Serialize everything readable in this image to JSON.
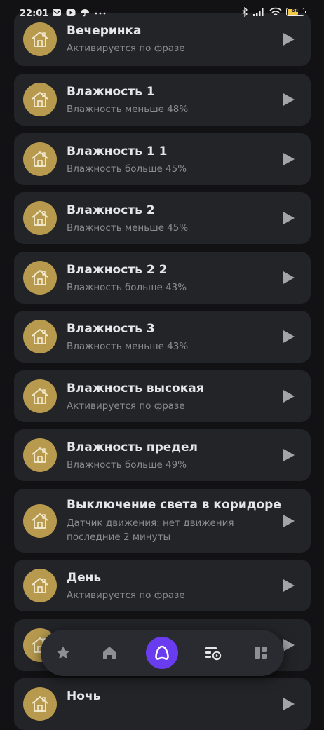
{
  "status_bar": {
    "time": "22:01",
    "battery": "68",
    "battery_level": 0.68,
    "left_icons": [
      "mail-icon",
      "youtube-icon",
      "umbrella-icon",
      "more-dots-icon"
    ],
    "right_icons": [
      "bluetooth-icon",
      "signal-icon",
      "wifi-icon",
      "battery-icon"
    ]
  },
  "colors": {
    "background": "#121214",
    "card": "#232428",
    "avatar": "#b79a4e",
    "accent": "#6a3cf0"
  },
  "scenarios": [
    {
      "title": "Вечеринка",
      "subtitle": "Активируется по фразе",
      "icon": "house-icon"
    },
    {
      "title": "Влажность 1",
      "subtitle": "Влажность меньше 48%",
      "icon": "house-icon"
    },
    {
      "title": "Влажность 1 1",
      "subtitle": "Влажность больше 45%",
      "icon": "house-icon"
    },
    {
      "title": "Влажность 2",
      "subtitle": "Влажность меньше 45%",
      "icon": "house-icon"
    },
    {
      "title": "Влажность 2 2",
      "subtitle": "Влажность больше 43%",
      "icon": "house-icon"
    },
    {
      "title": "Влажность 3",
      "subtitle": "Влажность меньше 43%",
      "icon": "house-icon"
    },
    {
      "title": "Влажность высокая",
      "subtitle": "Активируется по фразе",
      "icon": "house-icon"
    },
    {
      "title": "Влажность предел",
      "subtitle": "Влажность больше 49%",
      "icon": "house-icon"
    },
    {
      "title": "Выключение света в коридоре",
      "subtitle": "Датчик движения: нет движения последние 2 минуты",
      "icon": "house-icon"
    },
    {
      "title": "День",
      "subtitle": "Активируется по фразе",
      "icon": "house-icon"
    },
    {
      "title": "",
      "subtitle": "",
      "icon": "house-icon"
    },
    {
      "title": "Ночь",
      "subtitle": "",
      "icon": "house-icon"
    }
  ],
  "bottom_nav": {
    "items": [
      {
        "icon": "star-icon"
      },
      {
        "icon": "home-icon"
      },
      {
        "icon": "alice-icon"
      },
      {
        "icon": "scenarios-icon"
      },
      {
        "icon": "dashboard-icon"
      }
    ]
  }
}
